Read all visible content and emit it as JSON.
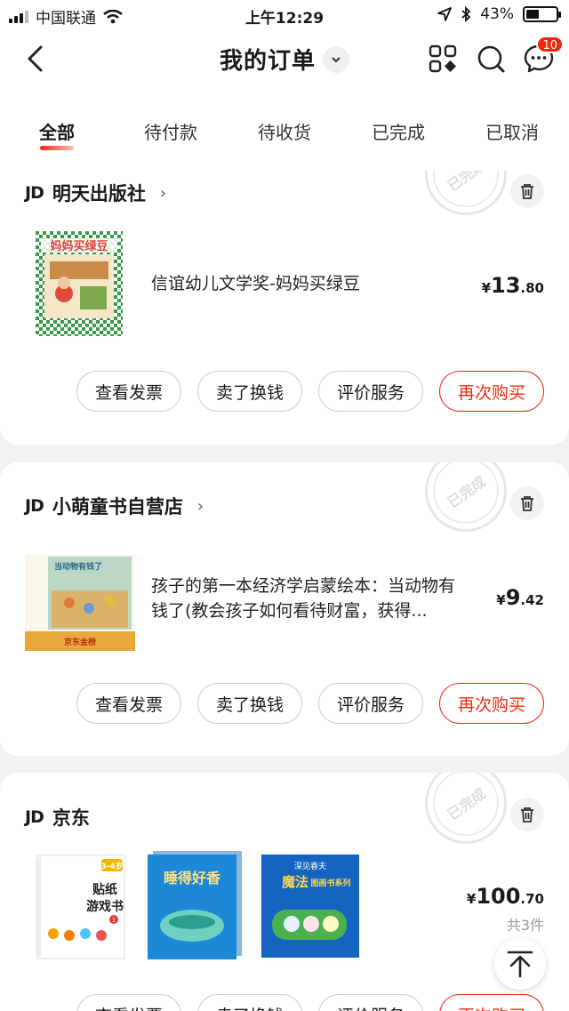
{
  "status_bar": {
    "carrier": "中国联通",
    "time": "上午12:29",
    "battery": "43%",
    "battery_level": 0.43
  },
  "header": {
    "title": "我的订单",
    "message_badge": "10"
  },
  "tabs": [
    {
      "label": "全部",
      "active": true
    },
    {
      "label": "待付款",
      "active": false
    },
    {
      "label": "待收货",
      "active": false
    },
    {
      "label": "已完成",
      "active": false
    },
    {
      "label": "已取消",
      "active": false
    }
  ],
  "orders": [
    {
      "shop_logo": "JD",
      "shop_name": "明天出版社",
      "stamp": "已完成",
      "product_name": "信谊幼儿文学奖-妈妈买绿豆",
      "price": {
        "yen": "¥",
        "int": "13",
        "dec": ".80"
      },
      "cover_title": "妈妈买绿豆",
      "buttons": [
        "查看发票",
        "卖了换钱",
        "评价服务",
        "再次购买"
      ]
    },
    {
      "shop_logo": "JD",
      "shop_name": "小萌童书自营店",
      "stamp": "已完成",
      "product_name": "孩子的第一本经济学启蒙绘本：当动物有钱了(教会孩子如何看待财富，获得...",
      "price": {
        "yen": "¥",
        "int": "9",
        "dec": ".42"
      },
      "cover_title": "当动物有钱了",
      "cover_banner": "京东金榜",
      "buttons": [
        "查看发票",
        "卖了换钱",
        "评价服务",
        "再次购买"
      ]
    },
    {
      "shop_logo": "JD",
      "shop_name": "京东",
      "stamp": "已完成",
      "price": {
        "yen": "¥",
        "int": "100",
        "dec": ".70"
      },
      "count": "共3件",
      "covers": [
        {
          "badge": "3-4岁",
          "line1": "贴纸",
          "line2": "游戏书",
          "num": "1"
        },
        {
          "title": "睡得好香"
        },
        {
          "line1": "深见春夫",
          "line2": "魔法",
          "line3": "图画书系列"
        }
      ],
      "buttons": [
        "查看发票",
        "卖了换钱",
        "评价服务",
        "再次购买"
      ]
    }
  ],
  "icons": {
    "back": "back-arrow-icon",
    "dropdown": "chevron-down-icon",
    "apps": "grid-apps-icon",
    "search": "search-icon",
    "message": "message-icon",
    "trash": "trash-icon",
    "to_top": "arrow-up-icon"
  },
  "colors": {
    "accent": "#f2270c",
    "background": "#f2f2f2"
  }
}
